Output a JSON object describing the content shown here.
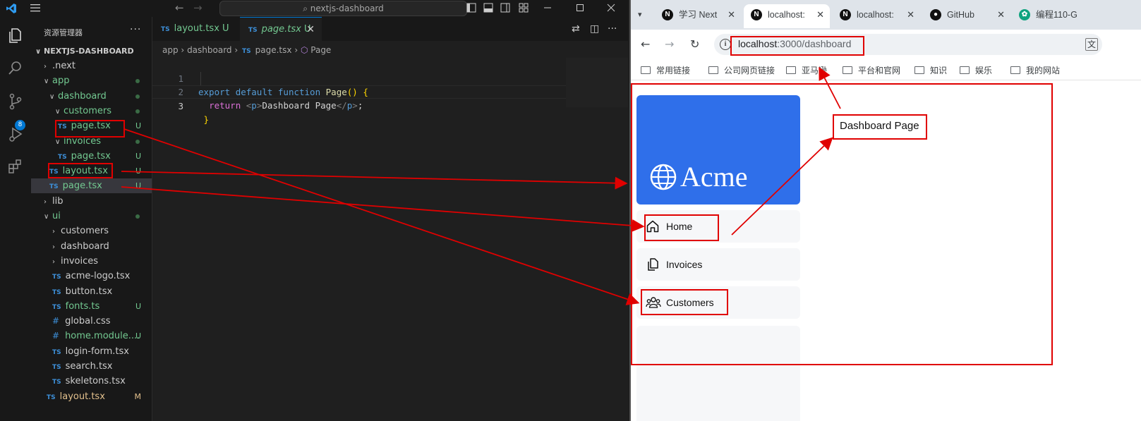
{
  "vscode": {
    "search_text": "nextjs-dashboard",
    "explorer_title": "资源管理器",
    "project": "NEXTJS-DASHBOARD",
    "source_control_badge": "8",
    "tree": [
      {
        "label": ".next",
        "kind": "folder",
        "open": false,
        "status": ""
      },
      {
        "label": "app",
        "kind": "folder",
        "open": true,
        "status": "dot"
      },
      {
        "label": "dashboard",
        "kind": "folder",
        "open": true,
        "status": "dot"
      },
      {
        "label": "customers",
        "kind": "folder",
        "open": true,
        "status": "dot"
      },
      {
        "label": "page.tsx",
        "kind": "ts",
        "status": "U"
      },
      {
        "label": "invoices",
        "kind": "folder",
        "open": true,
        "status": "dot"
      },
      {
        "label": "page.tsx",
        "kind": "ts",
        "status": "U"
      },
      {
        "label": "layout.tsx",
        "kind": "ts",
        "status": "U"
      },
      {
        "label": "page.tsx",
        "kind": "ts",
        "status": "U"
      },
      {
        "label": "lib",
        "kind": "folder",
        "open": false,
        "status": ""
      },
      {
        "label": "ui",
        "kind": "folder",
        "open": true,
        "status": "dot"
      },
      {
        "label": "customers",
        "kind": "folder",
        "open": false,
        "status": ""
      },
      {
        "label": "dashboard",
        "kind": "folder",
        "open": false,
        "status": ""
      },
      {
        "label": "invoices",
        "kind": "folder",
        "open": false,
        "status": ""
      },
      {
        "label": "acme-logo.tsx",
        "kind": "ts",
        "status": ""
      },
      {
        "label": "button.tsx",
        "kind": "ts",
        "status": ""
      },
      {
        "label": "fonts.ts",
        "kind": "ts",
        "status": "U"
      },
      {
        "label": "global.css",
        "kind": "css",
        "status": ""
      },
      {
        "label": "home.module....",
        "kind": "css",
        "status": "U"
      },
      {
        "label": "login-form.tsx",
        "kind": "ts",
        "status": ""
      },
      {
        "label": "search.tsx",
        "kind": "ts",
        "status": ""
      },
      {
        "label": "skeletons.tsx",
        "kind": "ts",
        "status": ""
      },
      {
        "label": "layout.tsx",
        "kind": "ts",
        "status": "M"
      }
    ],
    "tabs": [
      {
        "label": "layout.tsx",
        "status": "U",
        "active": false
      },
      {
        "label": "page.tsx",
        "status": "U",
        "active": true
      }
    ],
    "breadcrumb": {
      "a": "app",
      "b": "dashboard",
      "c": "page.tsx",
      "d": "Page"
    },
    "code": {
      "l1": {
        "n": "1",
        "kw1": "export",
        "kw2": "default",
        "kw3": "function",
        "fn": "Page",
        "rest": "() {"
      },
      "l2": {
        "n": "2",
        "ret": "return",
        "open_lt": "<",
        "open_tag": "p",
        "open_gt": ">",
        "text": "Dashboard Page",
        "close_lt": "</",
        "close_tag": "p",
        "close_gt": ">",
        "semi": ";"
      },
      "l3": {
        "n": "3",
        "brace": "}"
      }
    }
  },
  "browser": {
    "tabs": [
      {
        "label": "学习 Next",
        "icon": "N"
      },
      {
        "label": "localhost:",
        "icon": "N"
      },
      {
        "label": "localhost:",
        "icon": "N"
      },
      {
        "label": "GitHub",
        "icon": "gh"
      },
      {
        "label": "编程110-G",
        "icon": "ai"
      }
    ],
    "url_host": "localhost",
    "url_path": ":3000/dashboard",
    "bookmarks": [
      "常用链接",
      "公司网页链接",
      "亚马逊",
      "平台和官网",
      "知识",
      "娱乐",
      "我的网站"
    ],
    "page": {
      "logo_text": "Acme",
      "nav": [
        "Home",
        "Invoices",
        "Customers"
      ],
      "content_text": "Dashboard Page"
    }
  },
  "colors": {
    "accent": "#0078d4",
    "logo_bg": "#2f6fea",
    "annotation": "#e00000"
  }
}
